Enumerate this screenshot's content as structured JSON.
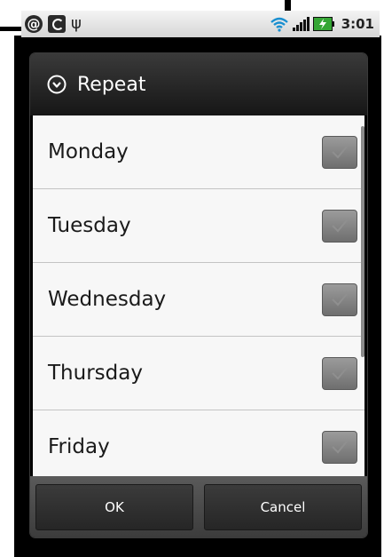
{
  "status_bar": {
    "notification_icons": [
      "at-sign-icon",
      "sync-icon",
      "usb-icon"
    ],
    "status_icons": [
      "wifi-icon",
      "signal-icon",
      "battery-charging-icon"
    ],
    "time": "3:01"
  },
  "dialog": {
    "title": "Repeat",
    "title_icon": "circle-chevron-down-icon",
    "days": [
      {
        "label": "Monday",
        "checked": true
      },
      {
        "label": "Tuesday",
        "checked": true
      },
      {
        "label": "Wednesday",
        "checked": true
      },
      {
        "label": "Thursday",
        "checked": true
      },
      {
        "label": "Friday",
        "checked": true
      }
    ],
    "ok_label": "OK",
    "cancel_label": "Cancel"
  },
  "colors": {
    "checkbox_fill": "#7d7d7d",
    "title_background": "#1f1f1f",
    "list_background": "#f7f7f7"
  }
}
